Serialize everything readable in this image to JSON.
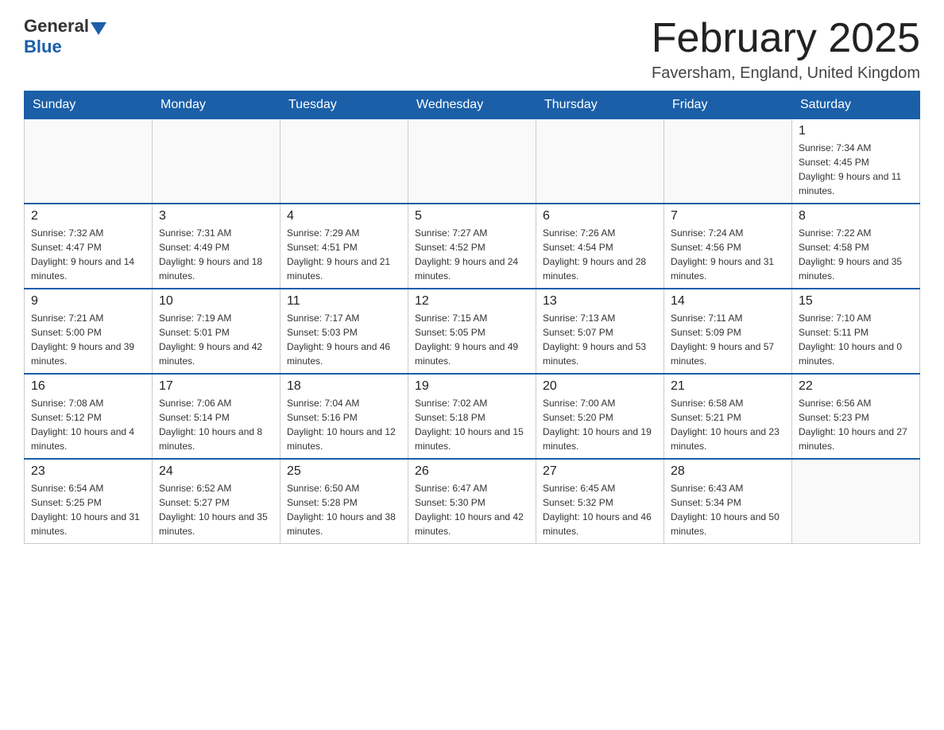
{
  "header": {
    "logo_general": "General",
    "logo_blue": "Blue",
    "month_title": "February 2025",
    "location": "Faversham, England, United Kingdom"
  },
  "weekdays": [
    "Sunday",
    "Monday",
    "Tuesday",
    "Wednesday",
    "Thursday",
    "Friday",
    "Saturday"
  ],
  "weeks": [
    [
      {
        "day": "",
        "info": ""
      },
      {
        "day": "",
        "info": ""
      },
      {
        "day": "",
        "info": ""
      },
      {
        "day": "",
        "info": ""
      },
      {
        "day": "",
        "info": ""
      },
      {
        "day": "",
        "info": ""
      },
      {
        "day": "1",
        "info": "Sunrise: 7:34 AM\nSunset: 4:45 PM\nDaylight: 9 hours and 11 minutes."
      }
    ],
    [
      {
        "day": "2",
        "info": "Sunrise: 7:32 AM\nSunset: 4:47 PM\nDaylight: 9 hours and 14 minutes."
      },
      {
        "day": "3",
        "info": "Sunrise: 7:31 AM\nSunset: 4:49 PM\nDaylight: 9 hours and 18 minutes."
      },
      {
        "day": "4",
        "info": "Sunrise: 7:29 AM\nSunset: 4:51 PM\nDaylight: 9 hours and 21 minutes."
      },
      {
        "day": "5",
        "info": "Sunrise: 7:27 AM\nSunset: 4:52 PM\nDaylight: 9 hours and 24 minutes."
      },
      {
        "day": "6",
        "info": "Sunrise: 7:26 AM\nSunset: 4:54 PM\nDaylight: 9 hours and 28 minutes."
      },
      {
        "day": "7",
        "info": "Sunrise: 7:24 AM\nSunset: 4:56 PM\nDaylight: 9 hours and 31 minutes."
      },
      {
        "day": "8",
        "info": "Sunrise: 7:22 AM\nSunset: 4:58 PM\nDaylight: 9 hours and 35 minutes."
      }
    ],
    [
      {
        "day": "9",
        "info": "Sunrise: 7:21 AM\nSunset: 5:00 PM\nDaylight: 9 hours and 39 minutes."
      },
      {
        "day": "10",
        "info": "Sunrise: 7:19 AM\nSunset: 5:01 PM\nDaylight: 9 hours and 42 minutes."
      },
      {
        "day": "11",
        "info": "Sunrise: 7:17 AM\nSunset: 5:03 PM\nDaylight: 9 hours and 46 minutes."
      },
      {
        "day": "12",
        "info": "Sunrise: 7:15 AM\nSunset: 5:05 PM\nDaylight: 9 hours and 49 minutes."
      },
      {
        "day": "13",
        "info": "Sunrise: 7:13 AM\nSunset: 5:07 PM\nDaylight: 9 hours and 53 minutes."
      },
      {
        "day": "14",
        "info": "Sunrise: 7:11 AM\nSunset: 5:09 PM\nDaylight: 9 hours and 57 minutes."
      },
      {
        "day": "15",
        "info": "Sunrise: 7:10 AM\nSunset: 5:11 PM\nDaylight: 10 hours and 0 minutes."
      }
    ],
    [
      {
        "day": "16",
        "info": "Sunrise: 7:08 AM\nSunset: 5:12 PM\nDaylight: 10 hours and 4 minutes."
      },
      {
        "day": "17",
        "info": "Sunrise: 7:06 AM\nSunset: 5:14 PM\nDaylight: 10 hours and 8 minutes."
      },
      {
        "day": "18",
        "info": "Sunrise: 7:04 AM\nSunset: 5:16 PM\nDaylight: 10 hours and 12 minutes."
      },
      {
        "day": "19",
        "info": "Sunrise: 7:02 AM\nSunset: 5:18 PM\nDaylight: 10 hours and 15 minutes."
      },
      {
        "day": "20",
        "info": "Sunrise: 7:00 AM\nSunset: 5:20 PM\nDaylight: 10 hours and 19 minutes."
      },
      {
        "day": "21",
        "info": "Sunrise: 6:58 AM\nSunset: 5:21 PM\nDaylight: 10 hours and 23 minutes."
      },
      {
        "day": "22",
        "info": "Sunrise: 6:56 AM\nSunset: 5:23 PM\nDaylight: 10 hours and 27 minutes."
      }
    ],
    [
      {
        "day": "23",
        "info": "Sunrise: 6:54 AM\nSunset: 5:25 PM\nDaylight: 10 hours and 31 minutes."
      },
      {
        "day": "24",
        "info": "Sunrise: 6:52 AM\nSunset: 5:27 PM\nDaylight: 10 hours and 35 minutes."
      },
      {
        "day": "25",
        "info": "Sunrise: 6:50 AM\nSunset: 5:28 PM\nDaylight: 10 hours and 38 minutes."
      },
      {
        "day": "26",
        "info": "Sunrise: 6:47 AM\nSunset: 5:30 PM\nDaylight: 10 hours and 42 minutes."
      },
      {
        "day": "27",
        "info": "Sunrise: 6:45 AM\nSunset: 5:32 PM\nDaylight: 10 hours and 46 minutes."
      },
      {
        "day": "28",
        "info": "Sunrise: 6:43 AM\nSunset: 5:34 PM\nDaylight: 10 hours and 50 minutes."
      },
      {
        "day": "",
        "info": ""
      }
    ]
  ]
}
